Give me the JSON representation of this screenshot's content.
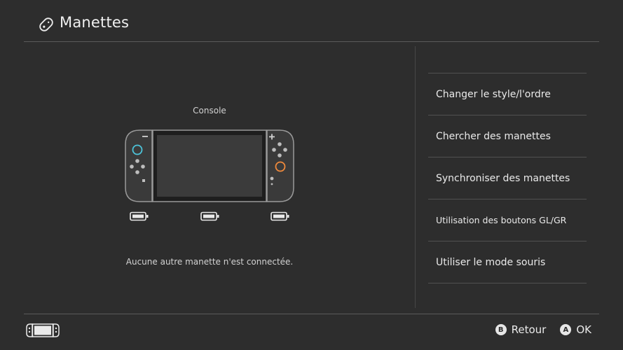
{
  "header": {
    "title": "Manettes",
    "icon": "joycon-icon"
  },
  "console": {
    "label": "Console",
    "no_controller_text": "Aucune autre manette n'est connectée.",
    "left_joycon_accent": "#4cc3d9",
    "right_joycon_accent": "#f08a3c"
  },
  "menu": {
    "items": [
      {
        "label": "Changer le style/l'ordre"
      },
      {
        "label": "Chercher des manettes"
      },
      {
        "label": "Synchroniser des manettes"
      },
      {
        "label": "Utilisation des boutons GL/GR"
      },
      {
        "label": "Utiliser le mode souris"
      }
    ]
  },
  "footer": {
    "back": {
      "button": "B",
      "label": "Retour"
    },
    "ok": {
      "button": "A",
      "label": "OK"
    }
  }
}
